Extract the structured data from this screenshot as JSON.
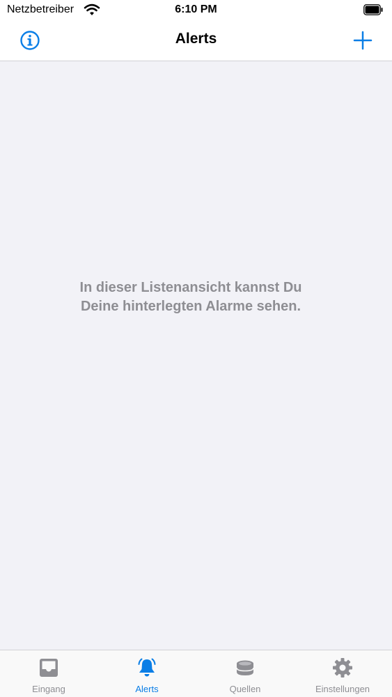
{
  "status_bar": {
    "carrier": "Netzbetreiber",
    "time": "6:10 PM",
    "wifi_icon": "wifi-icon",
    "battery_icon": "battery-icon"
  },
  "nav_bar": {
    "title": "Alerts",
    "left_icon": "info-circle-icon",
    "right_icon": "plus-icon"
  },
  "main": {
    "empty_message_line1": "In dieser Listenansicht kannst Du",
    "empty_message_line2": "Deine hinterlegten Alarme sehen."
  },
  "tab_bar": {
    "tabs": [
      {
        "label": "Eingang",
        "icon": "inbox-icon",
        "active": false
      },
      {
        "label": "Alerts",
        "icon": "bell-icon",
        "active": true
      },
      {
        "label": "Quellen",
        "icon": "database-icon",
        "active": false
      },
      {
        "label": "Einstellungen",
        "icon": "gear-icon",
        "active": false
      }
    ]
  },
  "colors": {
    "accent": "#0a7ee6",
    "inactive": "#8e8e93",
    "background": "#f2f2f7"
  }
}
